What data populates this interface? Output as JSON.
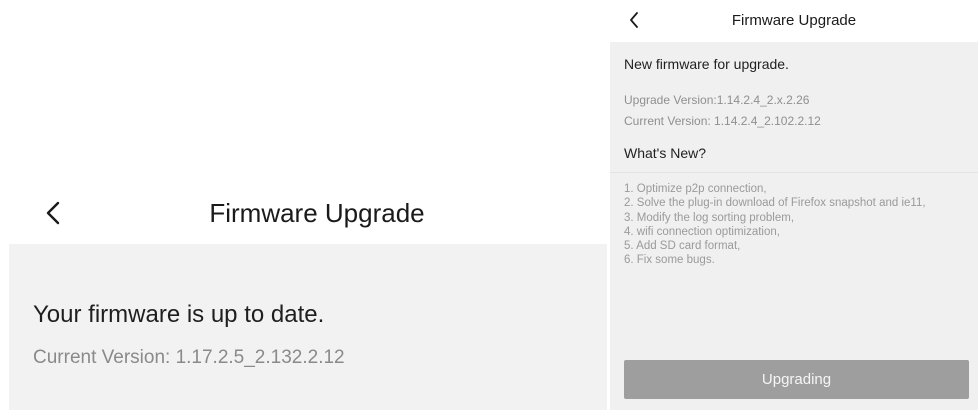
{
  "left_screen": {
    "title": "Firmware Upgrade",
    "status": "Your firmware is up to date.",
    "current_version": "Current Version: 1.17.2.5_2.132.2.12",
    "back_icon": "chevron-left-icon"
  },
  "right_screen": {
    "title": "Firmware Upgrade",
    "heading": "New firmware for upgrade.",
    "upgrade_version": "Upgrade Version:1.14.2.4_2.x.2.26",
    "current_version": "Current Version: 1.14.2.4_2.102.2.12",
    "whats_new_label": "What's New?",
    "release_notes": [
      "1. Optimize p2p connection,",
      "2. Solve the plug-in download of Firefox snapshot and ie11,",
      "3. Modify the log sorting problem,",
      "4. wifi connection optimization,",
      "5. Add SD card format,",
      "6. Fix some bugs."
    ],
    "button_label": "Upgrading",
    "back_icon": "chevron-left-icon"
  },
  "colors": {
    "screen_background": "#f2f2f2",
    "header_background": "#ffffff",
    "primary_text": "#1f1f1f",
    "secondary_text": "#8a8a8a",
    "button_background": "#9e9e9e",
    "button_text": "#f5f5f5"
  }
}
